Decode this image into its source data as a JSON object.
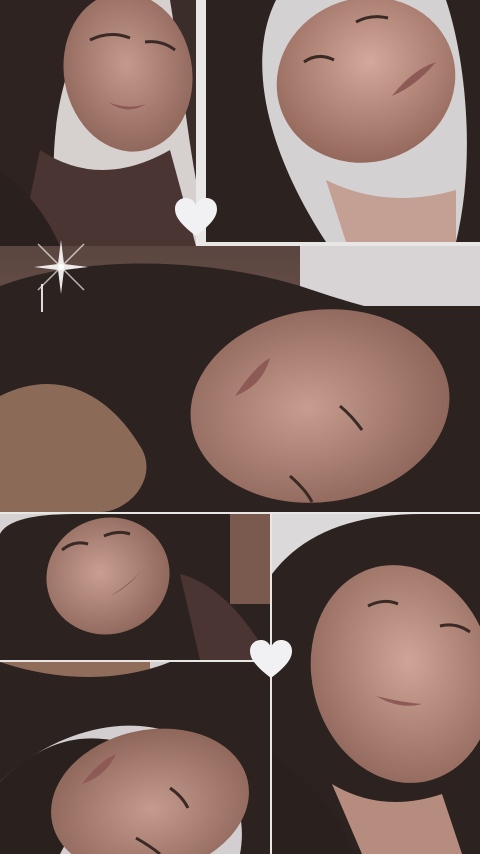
{
  "collage": {
    "photos": [
      {
        "id": "photo-top-left",
        "orientation": "upright-tilted"
      },
      {
        "id": "photo-top-right",
        "orientation": "upright-tilted"
      },
      {
        "id": "photo-middle-wide",
        "orientation": "rotated-sideways"
      },
      {
        "id": "photo-bottom-left-upper",
        "orientation": "upright-tilted"
      },
      {
        "id": "photo-bottom-left-lower",
        "orientation": "upside-down"
      },
      {
        "id": "photo-bottom-right",
        "orientation": "upright-tilted"
      }
    ],
    "decorations": {
      "hearts": [
        "heart-icon",
        "heart-icon"
      ],
      "sparkle": "sparkle-icon"
    },
    "colors": {
      "background": "#e9e6e6",
      "skin": "#b98e83",
      "skin_shadow": "#8a6256",
      "hair": "#2c2220",
      "lips": "#8e5a55",
      "wall": "#d9d6d8",
      "heart": "#f1f0f2"
    }
  }
}
